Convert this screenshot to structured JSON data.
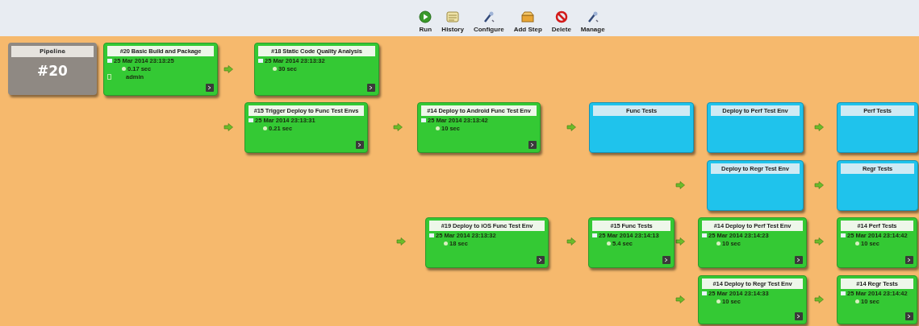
{
  "toolbar": [
    {
      "label": "Run",
      "kind": "run"
    },
    {
      "label": "History",
      "kind": "history"
    },
    {
      "label": "Configure",
      "kind": "configure"
    },
    {
      "label": "Add Step",
      "kind": "add"
    },
    {
      "label": "Delete",
      "kind": "delete"
    },
    {
      "label": "Manage",
      "kind": "manage"
    }
  ],
  "pipeline": {
    "label": "Pipeline",
    "number": "#20"
  },
  "builds": [
    {
      "title": "#20 Basic Build and Package",
      "kind": "success",
      "date": "25 Mar 2014 23:13:25",
      "duration": "0.17 sec",
      "user": "admin"
    },
    {
      "title": "#18 Static Code Quality Analysis",
      "kind": "success",
      "date": "25 Mar 2014 23:13:32",
      "duration": "30 sec"
    },
    {
      "title": "#15 Trigger Deploy to Func Test Envs",
      "kind": "success",
      "date": "25 Mar 2014 23:13:31",
      "duration": "0.21 sec"
    },
    {
      "title": "#14 Deploy to Android Func Test Env",
      "kind": "success",
      "date": "25 Mar 2014 23:13:42",
      "duration": "10 sec"
    },
    {
      "title": "Func Tests",
      "kind": "pending"
    },
    {
      "title": "Deploy to Perf Test Env",
      "kind": "pending"
    },
    {
      "title": "Perf Tests",
      "kind": "pending"
    },
    {
      "title": "Deploy to Regr Test Env",
      "kind": "pending"
    },
    {
      "title": "Regr Tests",
      "kind": "pending"
    },
    {
      "title": "#19 Deploy to iOS Func Test Env",
      "kind": "success",
      "date": "25 Mar 2014 23:13:32",
      "duration": "18 sec"
    },
    {
      "title": "#15 Func Tests",
      "kind": "success",
      "date": "25 Mar 2014 23:14:13",
      "duration": "5.4 sec"
    },
    {
      "title": "#14 Deploy to Perf Test Env",
      "kind": "success",
      "date": "25 Mar 2014 23:14:23",
      "duration": "10 sec"
    },
    {
      "title": "#14 Perf Tests",
      "kind": "success",
      "date": "25 Mar 2014 23:14:42",
      "duration": "10 sec"
    },
    {
      "title": "#14 Deploy to Regr Test Env",
      "kind": "success",
      "date": "25 Mar 2014 23:14:33",
      "duration": "10 sec"
    },
    {
      "title": "#14 Regr Tests",
      "kind": "success",
      "date": "25 Mar 2014 23:14:42",
      "duration": "10 sec"
    }
  ]
}
